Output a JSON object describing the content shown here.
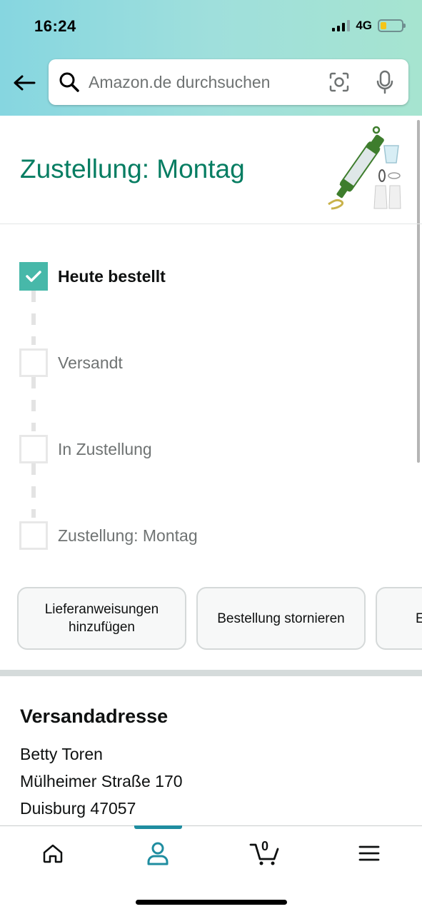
{
  "status_bar": {
    "time": "16:24",
    "network": "4G"
  },
  "search": {
    "placeholder": "Amazon.de durchsuchen"
  },
  "header": {
    "delivery_title": "Zustellung: Montag",
    "product_image": "water-filter-straw-product"
  },
  "timeline": {
    "steps": [
      {
        "label": "Heute bestellt",
        "done": true
      },
      {
        "label": "Versandt",
        "done": false
      },
      {
        "label": "In Zustellung",
        "done": false
      },
      {
        "label": "Zustellung: Montag",
        "done": false
      }
    ]
  },
  "actions": {
    "delivery_instructions": "Lieferanweisungen hinzufügen",
    "cancel_order": "Bestellung stornieren",
    "third_partial": "E"
  },
  "address": {
    "title": "Versandadresse",
    "name": "Betty Toren",
    "street": "Mülheimer Straße 170",
    "city": "Duisburg 47057"
  },
  "bottom_nav": {
    "items": [
      "home-icon",
      "account-icon",
      "cart-icon",
      "menu-icon"
    ],
    "active": "account-icon",
    "cart_count": "0"
  },
  "colors": {
    "accent": "#067d62",
    "check": "#47b8a9",
    "nav_active": "#1f8da0"
  }
}
